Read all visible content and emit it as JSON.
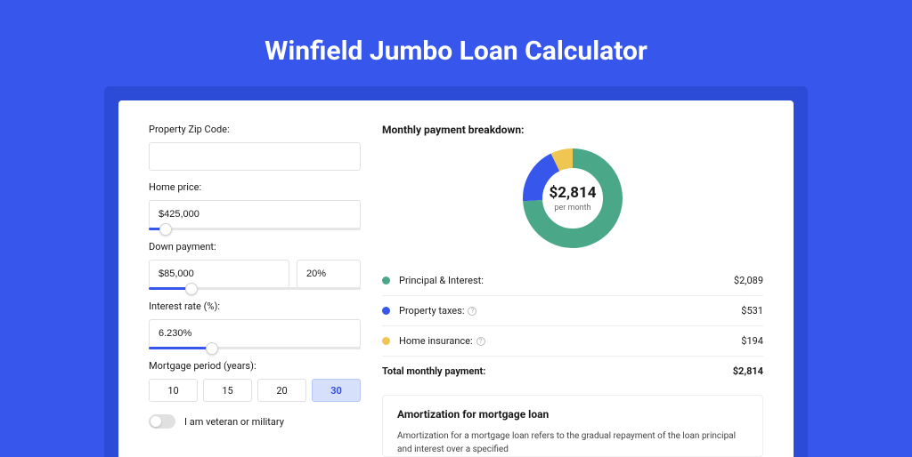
{
  "page": {
    "title": "Winfield Jumbo Loan Calculator"
  },
  "form": {
    "zip_label": "Property Zip Code:",
    "zip_value": "",
    "price_label": "Home price:",
    "price_value": "$425,000",
    "price_slider_pct": 8,
    "down_label": "Down payment:",
    "down_value": "$85,000",
    "down_pct_value": "20%",
    "down_slider_pct": 20,
    "rate_label": "Interest rate (%):",
    "rate_value": "6.230%",
    "rate_slider_pct": 30,
    "period_label": "Mortgage period (years):",
    "periods": [
      {
        "label": "10",
        "active": false
      },
      {
        "label": "15",
        "active": false
      },
      {
        "label": "20",
        "active": false
      },
      {
        "label": "30",
        "active": true
      }
    ],
    "veteran_label": "I am veteran or military"
  },
  "breakdown": {
    "heading": "Monthly payment breakdown:",
    "center_value": "$2,814",
    "center_sub": "per month",
    "rows": [
      {
        "label": "Principal & Interest:",
        "value": "$2,089",
        "color": "#4aa888",
        "info": false
      },
      {
        "label": "Property taxes:",
        "value": "$531",
        "color": "#3656ec",
        "info": true
      },
      {
        "label": "Home insurance:",
        "value": "$194",
        "color": "#eec651",
        "info": true
      }
    ],
    "total_label": "Total monthly payment:",
    "total_value": "$2,814"
  },
  "chart_data": {
    "type": "pie",
    "title": "Monthly payment breakdown",
    "series": [
      {
        "name": "Principal & Interest",
        "value": 2089,
        "color": "#4aa888"
      },
      {
        "name": "Property taxes",
        "value": 531,
        "color": "#3656ec"
      },
      {
        "name": "Home insurance",
        "value": 194,
        "color": "#eec651"
      }
    ],
    "total": 2814,
    "center_label": "$2,814 per month"
  },
  "amort": {
    "heading": "Amortization for mortgage loan",
    "body": "Amortization for a mortgage loan refers to the gradual repayment of the loan principal and interest over a specified"
  }
}
